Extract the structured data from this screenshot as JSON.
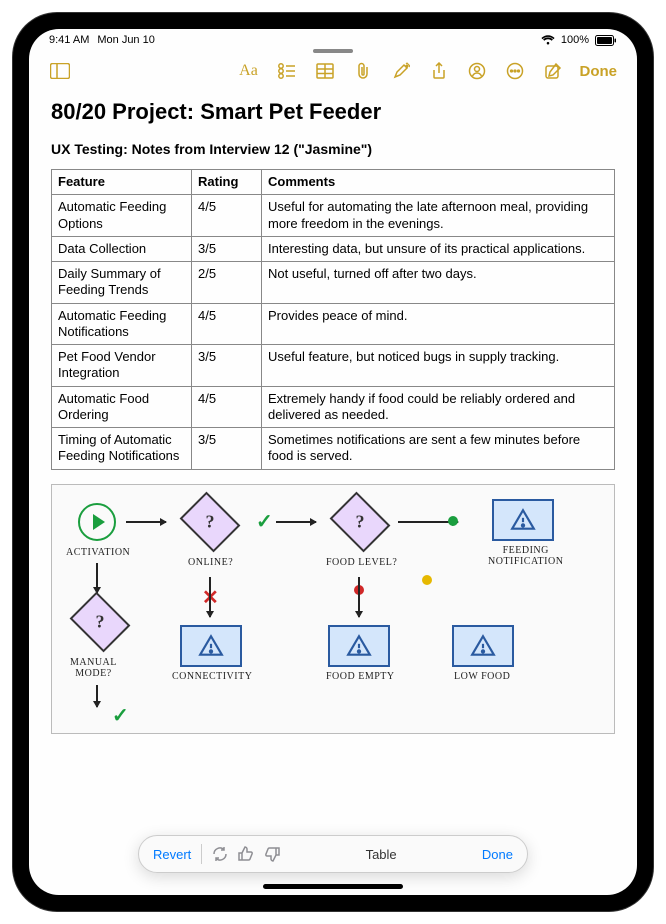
{
  "statusbar": {
    "time": "9:41 AM",
    "date": "Mon Jun 10",
    "battery": "100%"
  },
  "toolbar": {
    "done": "Done"
  },
  "note": {
    "title": "80/20 Project: Smart Pet Feeder",
    "subtitle": "UX Testing: Notes from Interview 12 (\"Jasmine\")"
  },
  "table": {
    "headers": [
      "Feature",
      "Rating",
      "Comments"
    ],
    "rows": [
      {
        "feature": "Automatic Feeding Options",
        "rating": "4/5",
        "comment": "Useful for automating the late afternoon meal, providing more freedom in the evenings."
      },
      {
        "feature": "Data Collection",
        "rating": "3/5",
        "comment": "Interesting data, but unsure of its practical applications."
      },
      {
        "feature": "Daily Summary of Feeding Trends",
        "rating": "2/5",
        "comment": "Not useful, turned off after two days."
      },
      {
        "feature": "Automatic Feeding Notifications",
        "rating": "4/5",
        "comment": "Provides peace of mind."
      },
      {
        "feature": "Pet Food Vendor Integration",
        "rating": "3/5",
        "comment": "Useful feature, but noticed bugs in supply tracking."
      },
      {
        "feature": "Automatic Food Ordering",
        "rating": "4/5",
        "comment": "Extremely handy if food could be reliably ordered and delivered as needed."
      },
      {
        "feature": "Timing of Automatic Feeding Notifications",
        "rating": "3/5",
        "comment": "Sometimes notifications are sent a few minutes before food is served."
      }
    ]
  },
  "chart_data": {
    "type": "diagram",
    "nodes": [
      {
        "id": "activation",
        "kind": "start",
        "label": "ACTIVATION"
      },
      {
        "id": "online",
        "kind": "decision",
        "label": "ONLINE?"
      },
      {
        "id": "food_level",
        "kind": "decision",
        "label": "FOOD LEVEL?"
      },
      {
        "id": "feeding_notification",
        "kind": "alert",
        "label": "FEEDING\nNOTIFICATION"
      },
      {
        "id": "manual_mode",
        "kind": "decision",
        "label": "MANUAL\nMODE?"
      },
      {
        "id": "connectivity",
        "kind": "alert",
        "label": "CONNECTIVITY"
      },
      {
        "id": "food_empty",
        "kind": "alert",
        "label": "FOOD EMPTY"
      },
      {
        "id": "low_food",
        "kind": "alert",
        "label": "LOW FOOD"
      }
    ],
    "edges": [
      {
        "from": "activation",
        "to": "online",
        "mark": "arrow"
      },
      {
        "from": "online",
        "to": "food_level",
        "mark": "check"
      },
      {
        "from": "food_level",
        "to": "feeding_notification",
        "mark": "green-dot"
      },
      {
        "from": "activation",
        "to": "manual_mode",
        "mark": "arrow-down"
      },
      {
        "from": "online",
        "to": "connectivity",
        "mark": "cross"
      },
      {
        "from": "food_level",
        "to": "food_empty",
        "mark": "red-dot"
      },
      {
        "from": "food_level",
        "to": "low_food",
        "mark": "yellow-dot"
      },
      {
        "from": "manual_mode",
        "to": "down",
        "mark": "check"
      }
    ]
  },
  "bottombar": {
    "revert": "Revert",
    "middle": "Table",
    "done": "Done"
  }
}
